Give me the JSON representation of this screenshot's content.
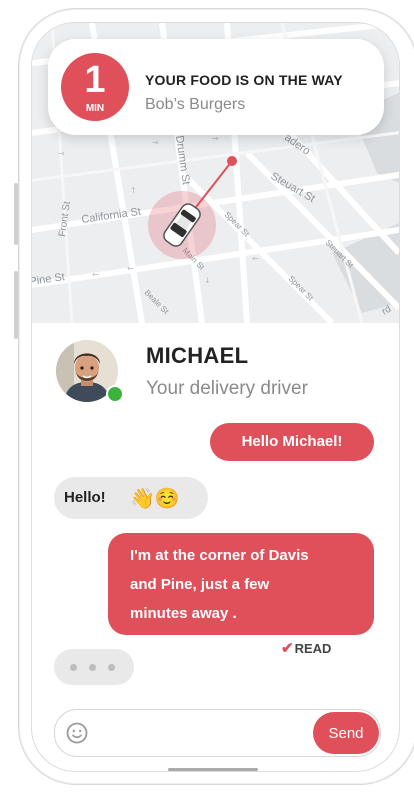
{
  "notification": {
    "eta_number": "1",
    "eta_unit": "MIN",
    "title": "YOUR FOOD IS ON THE WAY",
    "restaurant": "Bob’s Burgers"
  },
  "map": {
    "streets": [
      "Front St",
      "California St",
      "Pine St",
      "Beale St",
      "Main St",
      "Spear St",
      "Steuart St",
      "Drumm St"
    ],
    "partial_labels": [
      "adero",
      "rd",
      "urst"
    ]
  },
  "driver": {
    "name": "MICHAEL",
    "role": "Your delivery driver",
    "status": "online"
  },
  "chat": {
    "messages": [
      {
        "from": "me",
        "text": "Hello Michael!"
      },
      {
        "from": "driver",
        "text": "Hello!",
        "emoji": "👋☺️"
      },
      {
        "from": "me",
        "lines": [
          "I'm at the corner of Davis",
          "and Pine, just a few",
          "minutes away ."
        ]
      }
    ],
    "read_status": "READ",
    "typing_indicator": true
  },
  "composer": {
    "placeholder": "",
    "send_label": "Send"
  },
  "colors": {
    "accent": "#e0505a",
    "incoming_bubble": "#e9e9e9",
    "online": "#3cb43c"
  }
}
